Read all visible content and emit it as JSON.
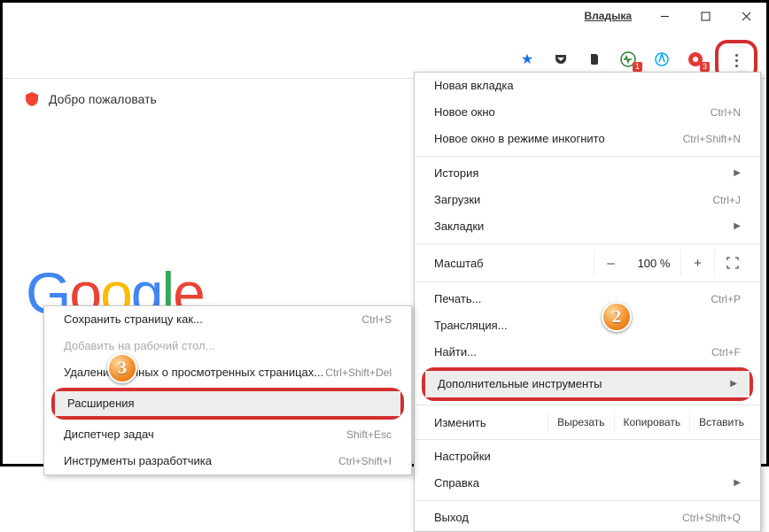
{
  "titlebar": {
    "username": "Владыка"
  },
  "welcome": "Добро пожаловать",
  "logo": [
    "G",
    "o",
    "o",
    "g",
    "l",
    "e"
  ],
  "toolbar_icons": [
    {
      "name": "bookmark-star-icon",
      "color": "#1a73e8"
    },
    {
      "name": "pocket-icon",
      "color": "#333"
    },
    {
      "name": "evernote-icon",
      "color": "#333"
    },
    {
      "name": "pulse-icon",
      "color": "#2e7d32",
      "badge": "1"
    },
    {
      "name": "opera-icon",
      "color": "#03a9f4"
    },
    {
      "name": "yandex-icon",
      "color": "#e53935",
      "badge": "3"
    }
  ],
  "menu": [
    {
      "label": "Новая вкладка",
      "sc": ""
    },
    {
      "label": "Новое окно",
      "sc": "Ctrl+N"
    },
    {
      "label": "Новое окно в режиме инкогнито",
      "sc": "Ctrl+Shift+N"
    },
    "sep",
    {
      "label": "История",
      "arrow": true
    },
    {
      "label": "Загрузки",
      "sc": "Ctrl+J"
    },
    {
      "label": "Закладки",
      "arrow": true
    },
    "sep",
    {
      "type": "zoom",
      "label": "Масштаб",
      "value": "100 %"
    },
    "sep",
    {
      "label": "Печать...",
      "sc": "Ctrl+P"
    },
    {
      "label": "Трансляция..."
    },
    {
      "label": "Найти...",
      "sc": "Ctrl+F"
    },
    {
      "type": "more",
      "label": "Дополнительные инструменты",
      "arrow": true
    },
    "sep",
    {
      "type": "edit",
      "label": "Изменить",
      "cut": "Вырезать",
      "copy": "Копировать",
      "paste": "Вставить"
    },
    "sep",
    {
      "label": "Настройки"
    },
    {
      "label": "Справка",
      "arrow": true
    },
    "sep",
    {
      "label": "Выход",
      "sc": "Ctrl+Shift+Q"
    }
  ],
  "submenu": [
    {
      "label": "Сохранить страницу как...",
      "sc": "Ctrl+S"
    },
    {
      "label": "Добавить на рабочий стол...",
      "disabled": true
    },
    "sep",
    {
      "label": "Удаление данных о просмотренных страницах...",
      "sc": "Ctrl+Shift+Del"
    },
    {
      "type": "ext",
      "label": "Расширения"
    },
    {
      "label": "Диспетчер задач",
      "sc": "Shift+Esc"
    },
    "sep",
    {
      "label": "Инструменты разработчика",
      "sc": "Ctrl+Shift+I"
    }
  ],
  "badges": {
    "b1": "1",
    "b2": "2",
    "b3": "3"
  }
}
